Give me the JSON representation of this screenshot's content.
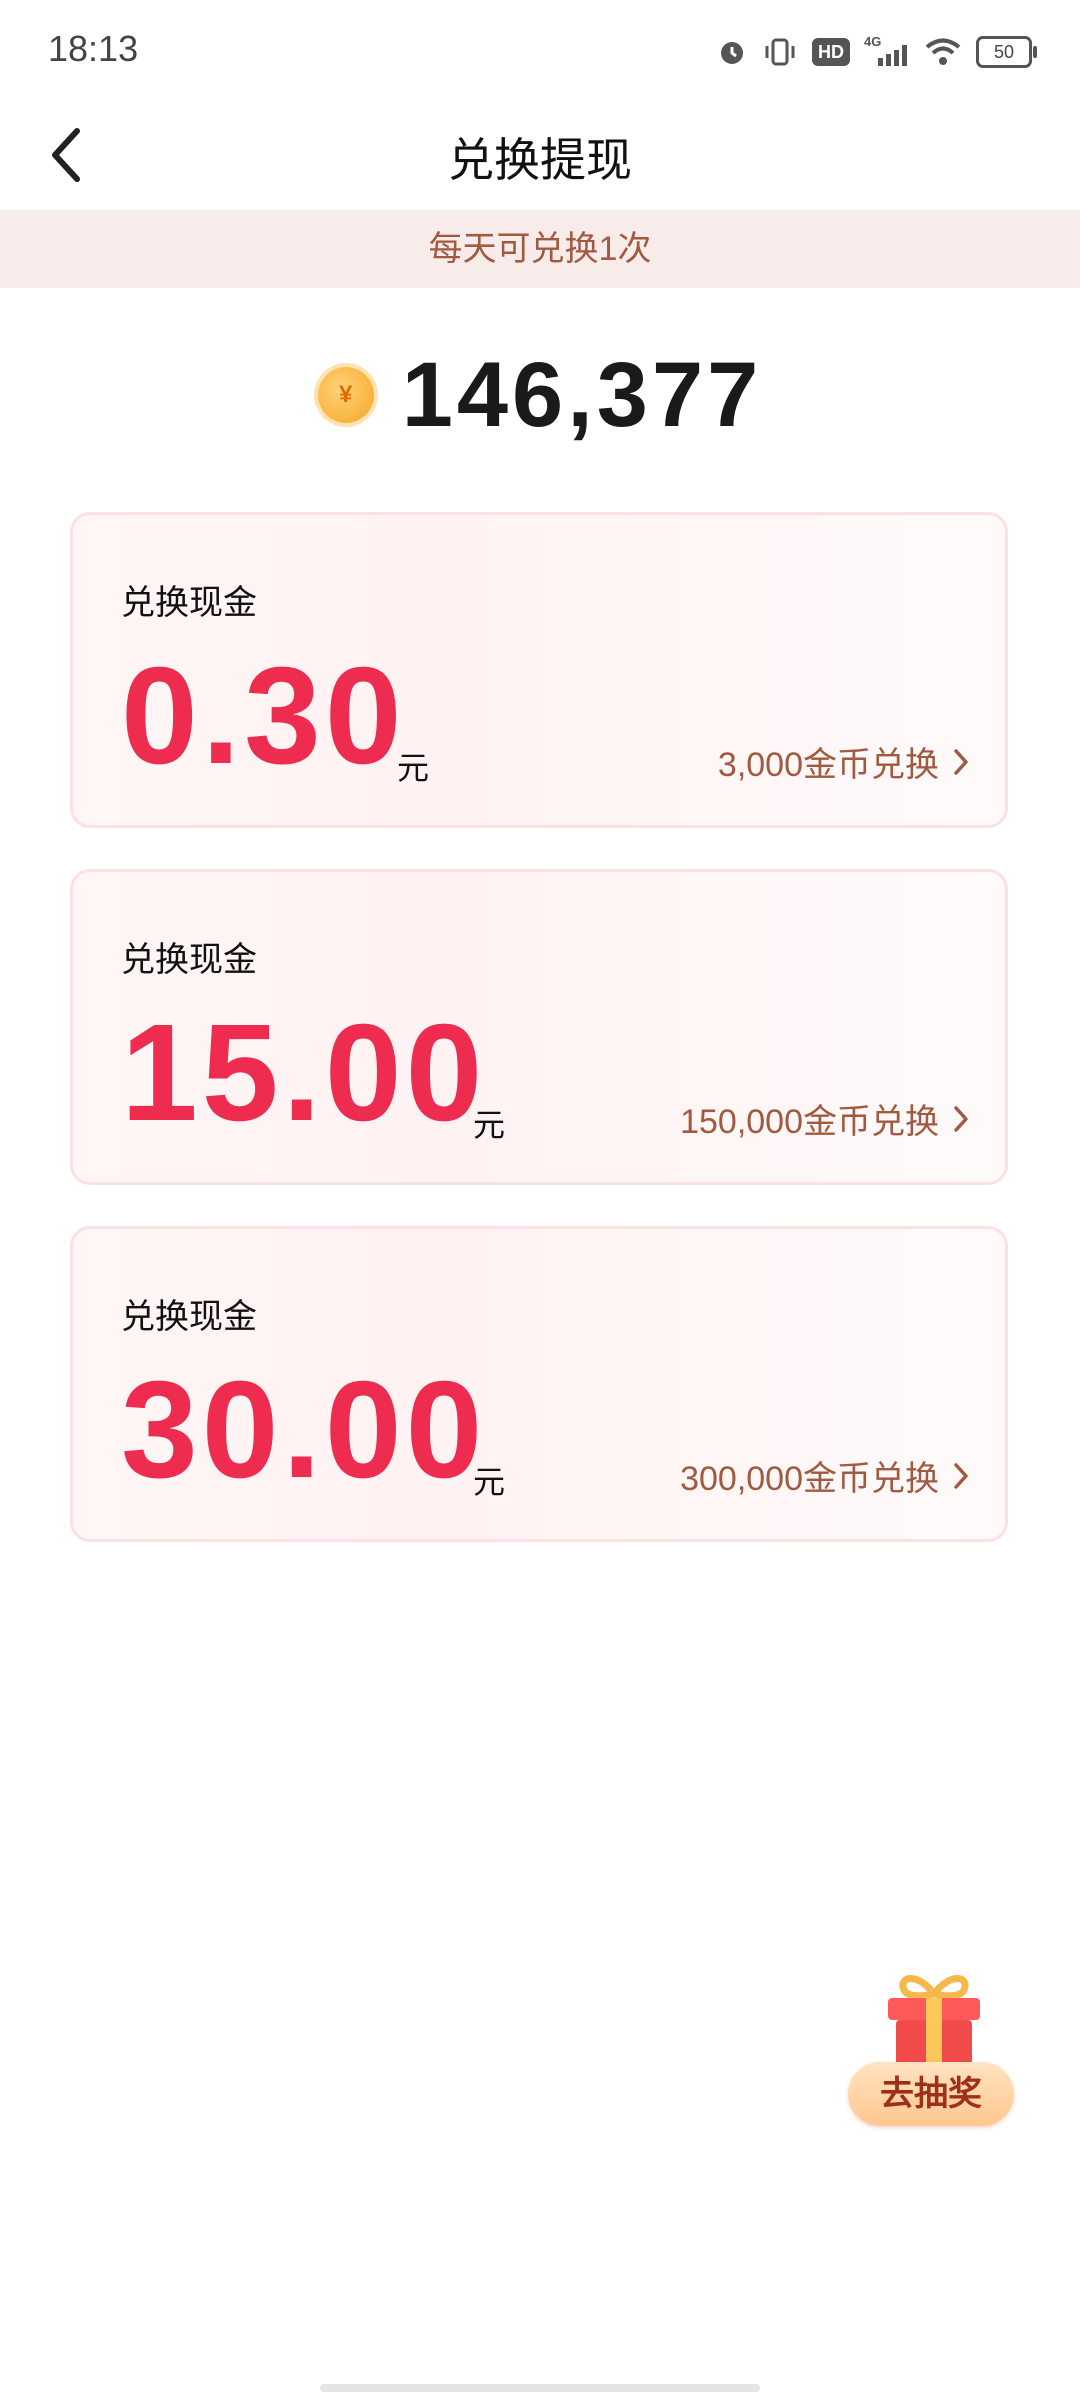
{
  "status_bar": {
    "time": "18:13",
    "hd_label": "HD",
    "network_label": "4G",
    "battery": "50"
  },
  "nav": {
    "title": "兑换提现"
  },
  "notice": "每天可兑换1次",
  "balance": {
    "coin_symbol": "¥",
    "value": "146,377"
  },
  "cards": [
    {
      "label": "兑换现金",
      "amount": "0.30",
      "unit": "元",
      "action": "3,000金币兑换"
    },
    {
      "label": "兑换现金",
      "amount": "15.00",
      "unit": "元",
      "action": "150,000金币兑换"
    },
    {
      "label": "兑换现金",
      "amount": "30.00",
      "unit": "元",
      "action": "300,000金币兑换"
    }
  ],
  "gift": {
    "label": "去抽奖"
  },
  "colors": {
    "accent_red": "#ee2c50",
    "action_brown": "#a05a40",
    "notice_bg": "#f8ecea"
  }
}
